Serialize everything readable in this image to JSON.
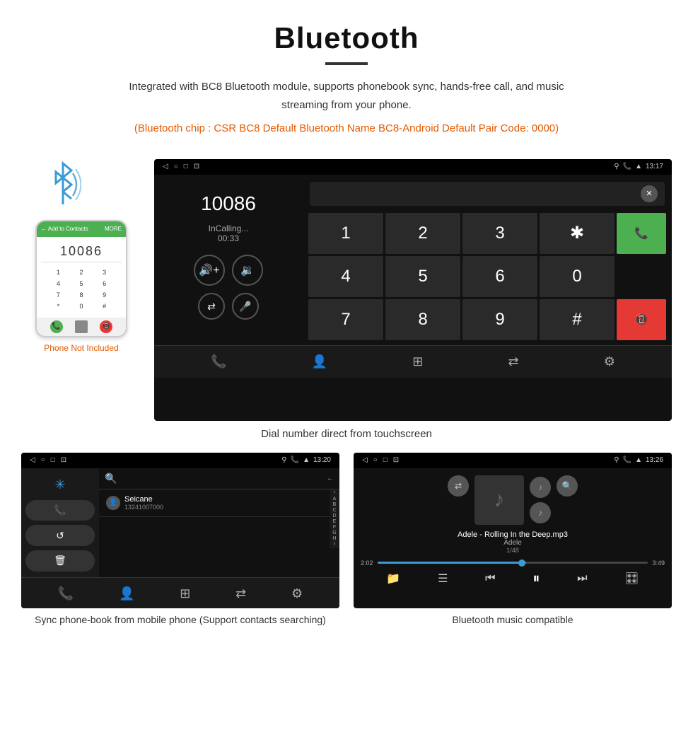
{
  "header": {
    "title": "Bluetooth",
    "description": "Integrated with BC8 Bluetooth module, supports phonebook sync, hands-free call, and music streaming from your phone.",
    "note": "(Bluetooth chip : CSR BC8    Default Bluetooth Name BC8-Android    Default Pair Code: 0000)"
  },
  "phone_not_included": "Phone Not Included",
  "dial_screen": {
    "status_bar": {
      "time": "13:17",
      "icons_left": [
        "◁",
        "○",
        "□",
        "⊡"
      ]
    },
    "number": "10086",
    "status": "InCalling...",
    "timer": "00:33",
    "keys": [
      "1",
      "2",
      "3",
      "✱",
      "4",
      "5",
      "6",
      "0",
      "7",
      "8",
      "9",
      "#"
    ],
    "call_accept": "📞",
    "call_reject": "📞"
  },
  "caption_dial": "Dial number direct from touchscreen",
  "phonebook_screen": {
    "status_bar_time": "13:20",
    "contact_name": "Seicane",
    "contact_phone": "13241007000",
    "alpha_list": [
      "*",
      "A",
      "B",
      "C",
      "D",
      "E",
      "F",
      "G",
      "H",
      "I"
    ]
  },
  "caption_phonebook": "Sync phone-book from mobile phone\n(Support contacts searching)",
  "music_screen": {
    "status_bar_time": "13:26",
    "song_title": "Adele - Rolling In the Deep.mp3",
    "artist": "Adele",
    "track_count": "1/48",
    "time_current": "2:02",
    "time_total": "3:49",
    "progress_pct": 55
  },
  "caption_music": "Bluetooth music compatible"
}
